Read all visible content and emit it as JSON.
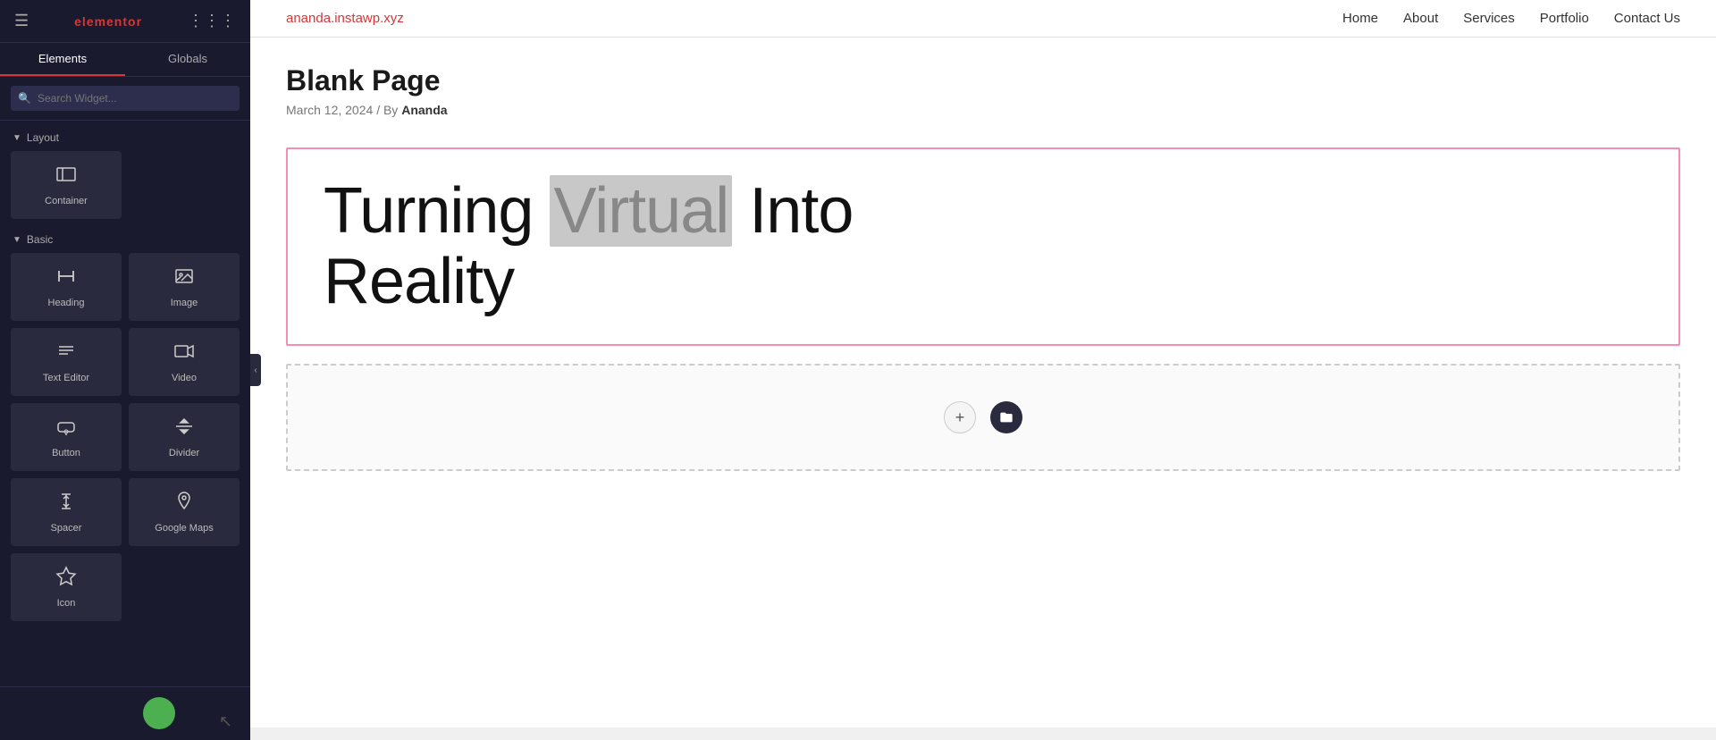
{
  "sidebar": {
    "logo": "elementor",
    "tabs": [
      {
        "label": "Elements",
        "active": true
      },
      {
        "label": "Globals",
        "active": false
      }
    ],
    "search_placeholder": "Search Widget...",
    "sections": {
      "layout": {
        "label": "Layout",
        "widgets": [
          {
            "id": "container",
            "label": "Container",
            "icon": "⬜"
          }
        ]
      },
      "basic": {
        "label": "Basic",
        "widgets": [
          {
            "id": "heading",
            "label": "Heading",
            "icon": "T"
          },
          {
            "id": "image",
            "label": "Image",
            "icon": "🖼"
          },
          {
            "id": "text-editor",
            "label": "Text Editor",
            "icon": "≡"
          },
          {
            "id": "video",
            "label": "Video",
            "icon": "▶"
          },
          {
            "id": "button",
            "label": "Button",
            "icon": "⬡"
          },
          {
            "id": "divider",
            "label": "Divider",
            "icon": "÷"
          },
          {
            "id": "spacer",
            "label": "Spacer",
            "icon": "↕"
          },
          {
            "id": "google-maps",
            "label": "Google Maps",
            "icon": "📍"
          },
          {
            "id": "icon",
            "label": "Icon",
            "icon": "★"
          }
        ]
      }
    }
  },
  "site": {
    "url": "ananda.instawp.xyz",
    "nav": [
      {
        "label": "Home",
        "href": "#"
      },
      {
        "label": "About",
        "href": "#"
      },
      {
        "label": "Services",
        "href": "#"
      },
      {
        "label": "Portfolio",
        "href": "#"
      },
      {
        "label": "Contact Us",
        "href": "#"
      }
    ]
  },
  "page": {
    "title": "Blank Page",
    "date": "March 12, 2024",
    "author": "Ananda",
    "hero_line1": "Turning",
    "hero_highlight": "Virtual",
    "hero_line1_end": "Into",
    "hero_line2": "Reality"
  },
  "toolbar": {
    "hamburger": "☰",
    "grid": "⋮⋮⋮",
    "collapse_arrow": "‹",
    "add_btn": "+",
    "folder_btn": "🗂"
  }
}
